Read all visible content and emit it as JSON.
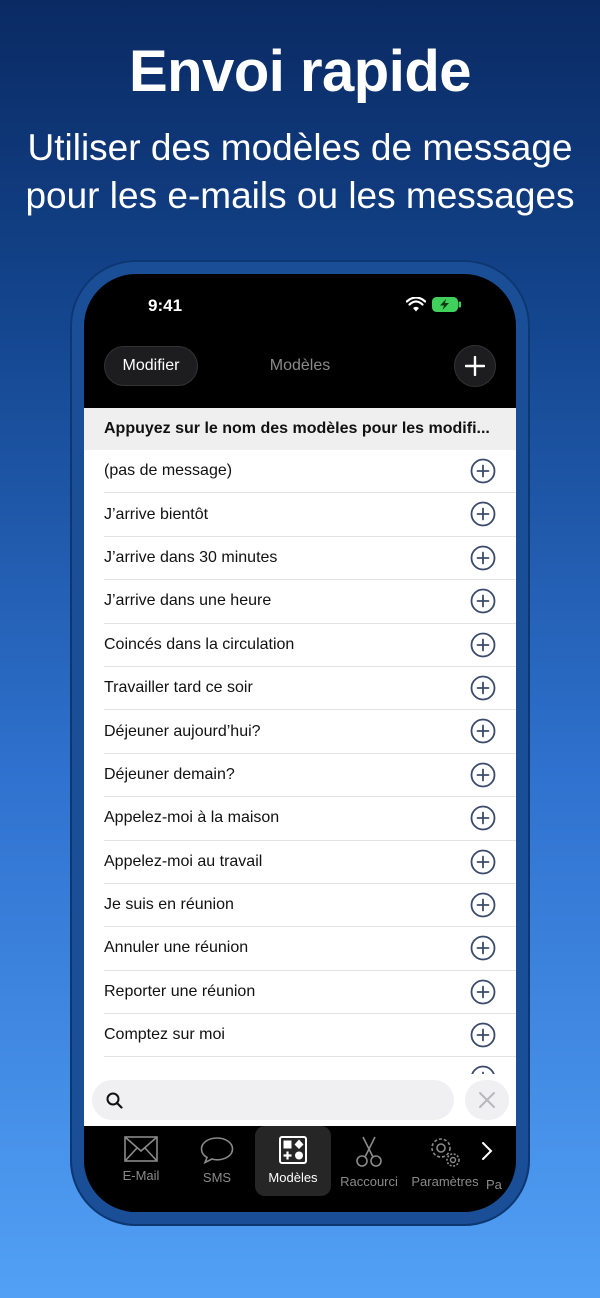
{
  "hero": {
    "title": "Envoi rapide",
    "subtitle_line1": "Utiliser des modèles de message",
    "subtitle_line2": "pour les e-mails ou les messages"
  },
  "status_bar": {
    "time": "9:41"
  },
  "navbar": {
    "edit_label": "Modifier",
    "title": "Modèles"
  },
  "hint": "Appuyez sur le nom des modèles pour les modifi...",
  "templates": [
    "(pas de message)",
    "J’arrive bientôt",
    "J’arrive dans 30 minutes",
    "J’arrive dans une heure",
    "Coincés dans la circulation",
    "Travailler tard ce soir",
    "Déjeuner aujourd’hui?",
    "Déjeuner demain?",
    "Appelez-moi à la maison",
    "Appelez-moi au travail",
    "Je suis en réunion",
    "Annuler une réunion",
    "Reporter une réunion",
    "Comptez sur moi"
  ],
  "search": {
    "placeholder": ""
  },
  "tabs": [
    {
      "label": "E-Mail",
      "icon": "envelope-icon"
    },
    {
      "label": "SMS",
      "icon": "chat-bubble-icon"
    },
    {
      "label": "Modèles",
      "icon": "templates-icon",
      "active": true
    },
    {
      "label": "Raccourci",
      "icon": "scissors-icon"
    },
    {
      "label": "Paramètres",
      "icon": "gears-icon"
    }
  ],
  "tab_partial": "Pa",
  "colors": {
    "accent_dark": "#3b4b6b",
    "tab_inactive": "#8a8a8a"
  }
}
